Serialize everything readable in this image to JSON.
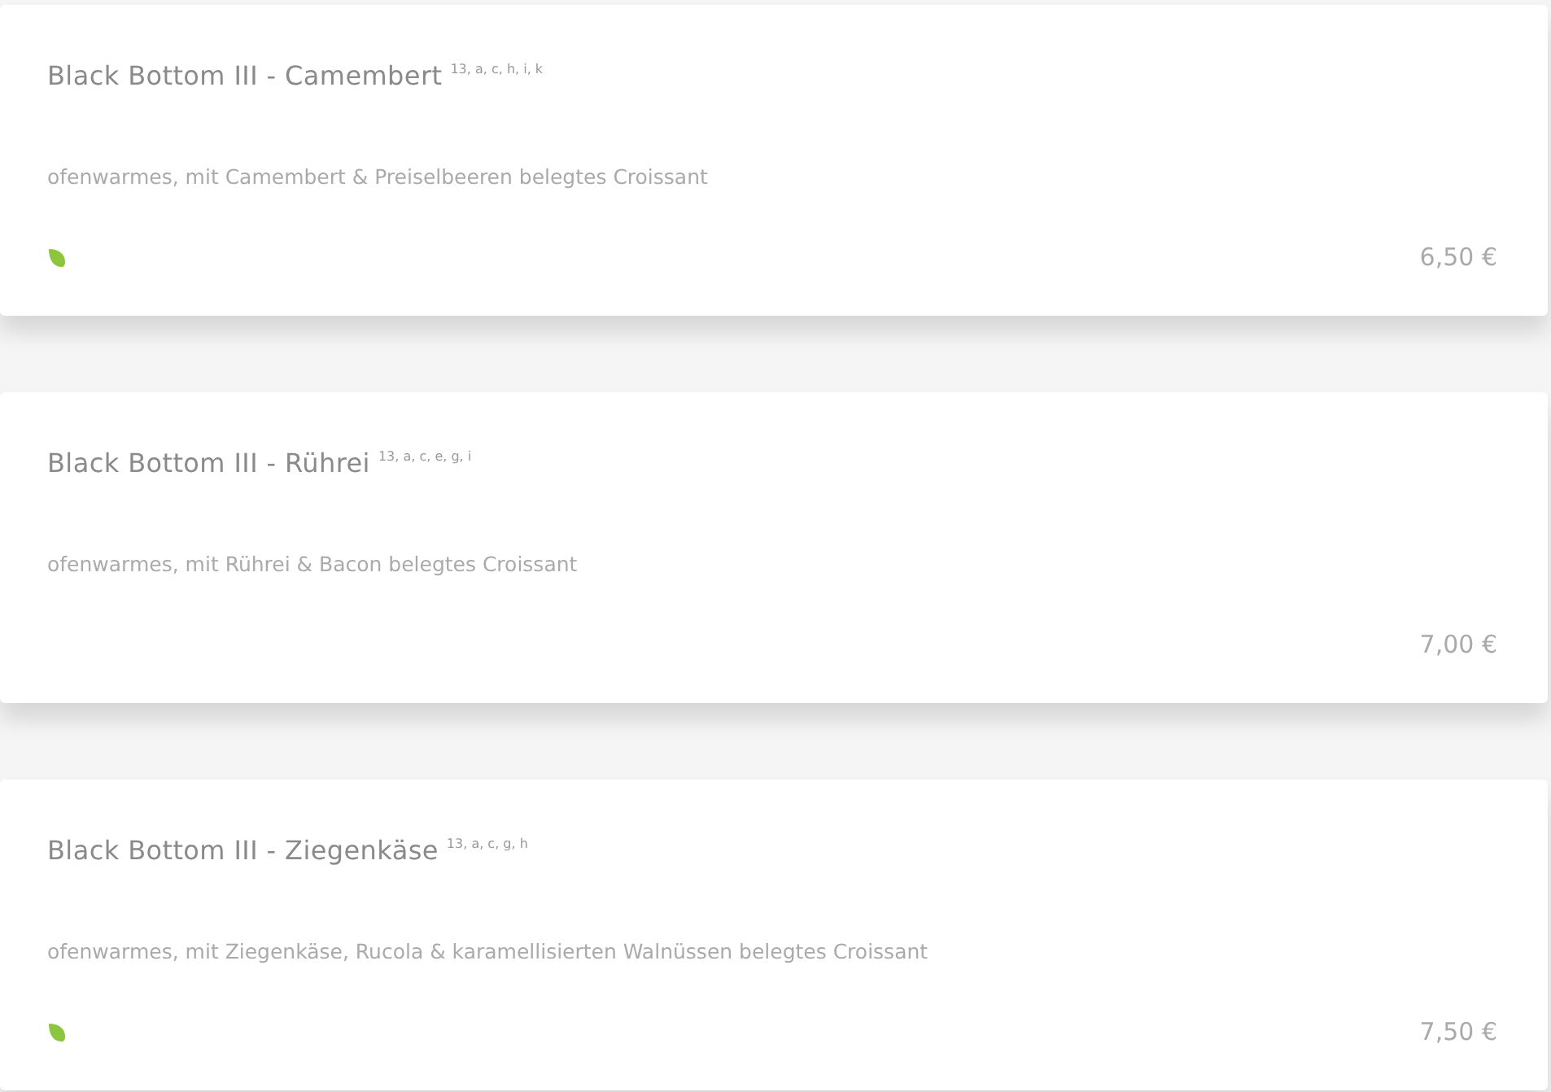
{
  "items": [
    {
      "name": "Black Bottom III - Camembert",
      "allergens": "13, a, c, h, i, k",
      "description": "ofenwarmes, mit Camembert & Preiselbeeren belegtes Croissant",
      "vegetarian": true,
      "price": "6,50 €"
    },
    {
      "name": "Black Bottom III - Rührei",
      "allergens": "13, a, c, e, g, i",
      "description": "ofenwarmes, mit Rührei & Bacon belegtes Croissant",
      "vegetarian": false,
      "price": "7,00 €"
    },
    {
      "name": "Black Bottom III - Ziegenkäse",
      "allergens": "13, a, c, g, h",
      "description": "ofenwarmes, mit Ziegenkäse, Rucola & karamellisierten Walnüssen belegtes Croissant",
      "vegetarian": true,
      "price": "7,50 €"
    }
  ]
}
